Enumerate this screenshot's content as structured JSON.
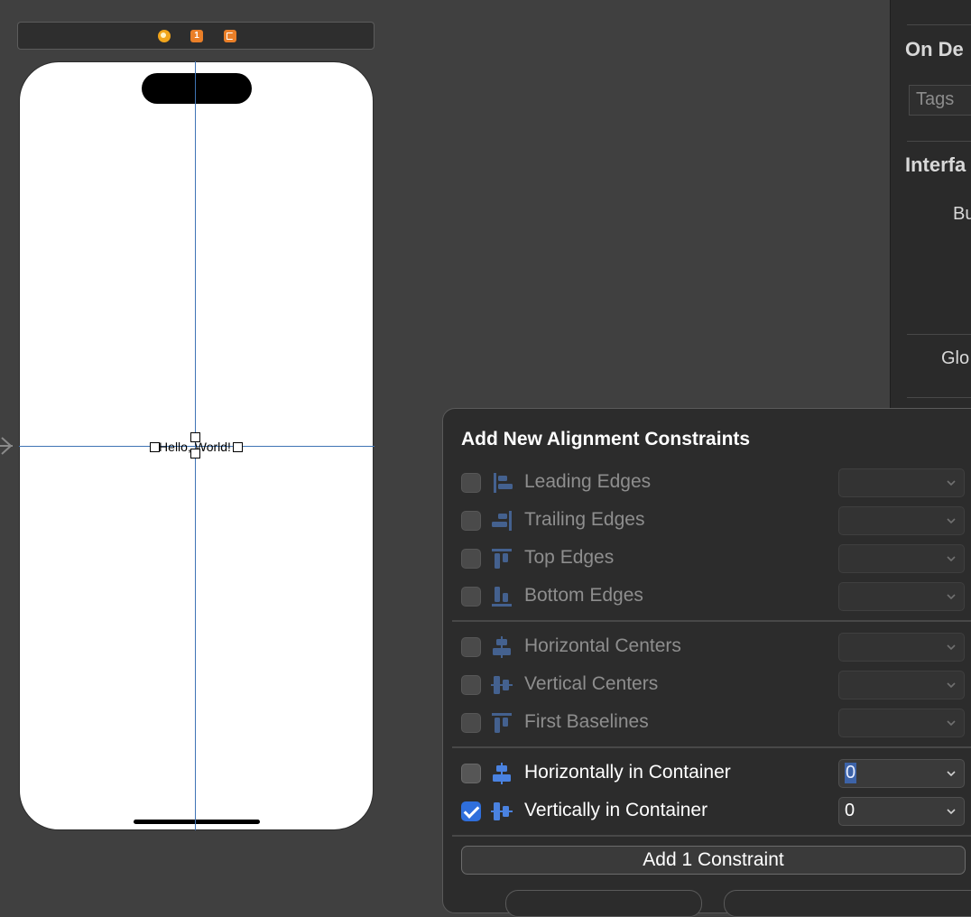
{
  "scene_bar": {
    "icons": [
      "view-controller-icon",
      "first-responder-icon",
      "exit-icon"
    ],
    "first_responder_glyph": "1"
  },
  "canvas": {
    "label_text": "Hello, World!"
  },
  "inspector": {
    "on_demand_heading": "On De",
    "tags_placeholder": "Tags",
    "interface_heading": "Interfa",
    "builder_label": "Bu",
    "global_label": "Glo"
  },
  "popover": {
    "title": "Add New Alignment Constraints",
    "groups": [
      [
        {
          "label": "Leading Edges",
          "icon": "leading-edges-icon",
          "enabled": false,
          "checked": false,
          "value": ""
        },
        {
          "label": "Trailing Edges",
          "icon": "trailing-edges-icon",
          "enabled": false,
          "checked": false,
          "value": ""
        },
        {
          "label": "Top Edges",
          "icon": "top-edges-icon",
          "enabled": false,
          "checked": false,
          "value": ""
        },
        {
          "label": "Bottom Edges",
          "icon": "bottom-edges-icon",
          "enabled": false,
          "checked": false,
          "value": ""
        }
      ],
      [
        {
          "label": "Horizontal Centers",
          "icon": "horizontal-centers-icon",
          "enabled": false,
          "checked": false,
          "value": ""
        },
        {
          "label": "Vertical Centers",
          "icon": "vertical-centers-icon",
          "enabled": false,
          "checked": false,
          "value": ""
        },
        {
          "label": "First Baselines",
          "icon": "first-baselines-icon",
          "enabled": false,
          "checked": false,
          "value": ""
        }
      ],
      [
        {
          "label": "Horizontally in Container",
          "icon": "horizontally-in-container-icon",
          "enabled": true,
          "checked": false,
          "value": "0"
        },
        {
          "label": "Vertically in Container",
          "icon": "vertically-in-container-icon",
          "enabled": true,
          "checked": true,
          "value": "0"
        }
      ]
    ],
    "add_button_label": "Add 1 Constraint"
  },
  "colors": {
    "guide_line": "#3f74b5",
    "checkbox_checked": "#2f6fdc",
    "icon_enabled": "#4a82e0",
    "icon_disabled": "#44618f"
  }
}
